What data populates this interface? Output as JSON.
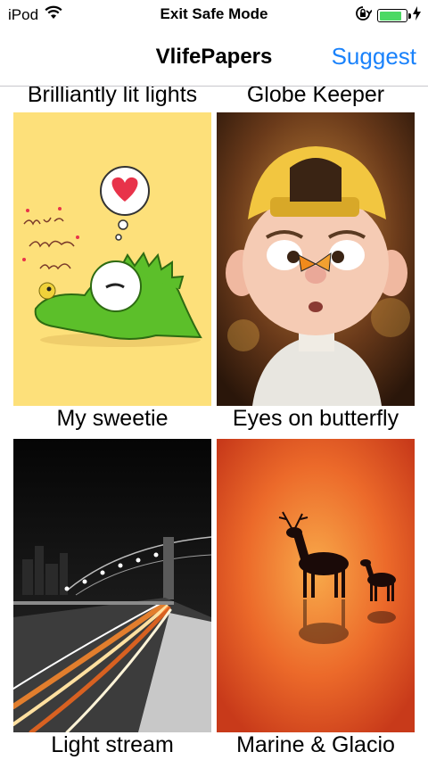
{
  "status_bar": {
    "device": "iPod",
    "center_text": "Exit Safe Mode",
    "battery_level": 0.85,
    "icons": [
      "wifi-icon",
      "orientation-lock-icon",
      "battery-icon",
      "charging-bolt-icon"
    ]
  },
  "nav": {
    "title": "VlifePapers",
    "action_label": "Suggest"
  },
  "colors": {
    "accent": "#1a82fb",
    "battery": "#4cd964"
  },
  "wallpapers": [
    {
      "label": "Brilliantly lit lights"
    },
    {
      "label": "Globe Keeper"
    },
    {
      "label": "My sweetie"
    },
    {
      "label": "Eyes on butterfly"
    },
    {
      "label": "Light stream"
    },
    {
      "label": "Marine & Glacio"
    }
  ]
}
